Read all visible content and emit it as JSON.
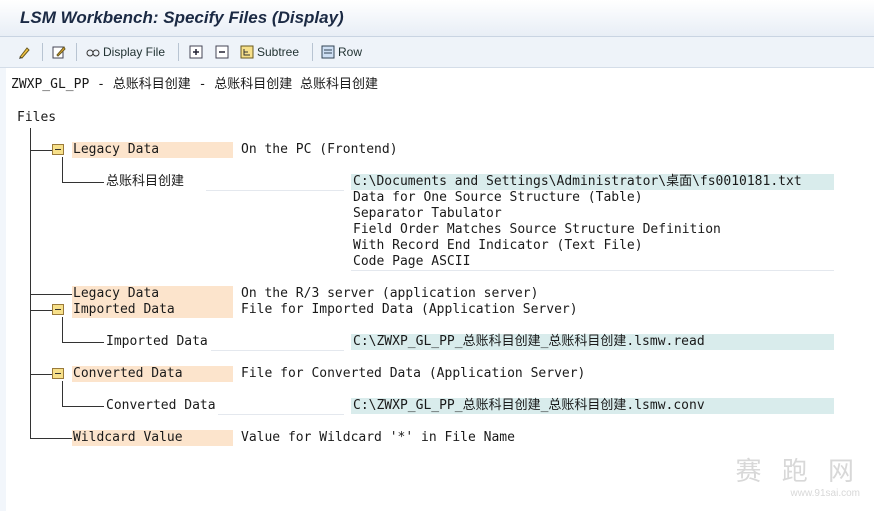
{
  "window": {
    "title": "LSM Workbench: Specify Files (Display)"
  },
  "toolbar": {
    "icons": [
      "edit-icon",
      "change-icon",
      "display-file-icon",
      "expand-icon",
      "collapse-icon",
      "subtree-icon",
      "row-icon"
    ],
    "display_file_label": "Display File",
    "subtree_label": "Subtree",
    "row_label": "Row"
  },
  "header_line": "ZWXP_GL_PP - 总账科目创建 - 总账科目创建 总账科目创建",
  "tree": {
    "root": "Files",
    "legacy_pc": {
      "label": "Legacy Data",
      "desc": "On the PC (Frontend)"
    },
    "pc_file": {
      "name": "总账科目创建",
      "path": "C:\\Documents and Settings\\Administrator\\桌面\\fs0010181.txt",
      "props": [
        "Data for One Source Structure (Table)",
        "Separator Tabulator",
        "Field Order Matches Source Structure Definition",
        "With Record End Indicator (Text File)",
        "Code Page ASCII"
      ]
    },
    "legacy_r3": {
      "label": "Legacy Data",
      "desc": "On the R/3 server (application server)"
    },
    "imported": {
      "label": "Imported Data",
      "desc": "File for Imported Data (Application Server)",
      "child_name": "Imported Data",
      "child_path": "C:\\ZWXP_GL_PP_总账科目创建_总账科目创建.lsmw.read"
    },
    "converted": {
      "label": "Converted Data",
      "desc": "File for Converted Data (Application Server)",
      "child_name": "Converted Data",
      "child_path": "C:\\ZWXP_GL_PP_总账科目创建_总账科目创建.lsmw.conv"
    },
    "wildcard": {
      "label": "Wildcard Value",
      "desc": "Value for Wildcard '*' in File Name"
    }
  },
  "watermark": {
    "text": "赛 跑 网",
    "url": "www.91sai.com"
  }
}
